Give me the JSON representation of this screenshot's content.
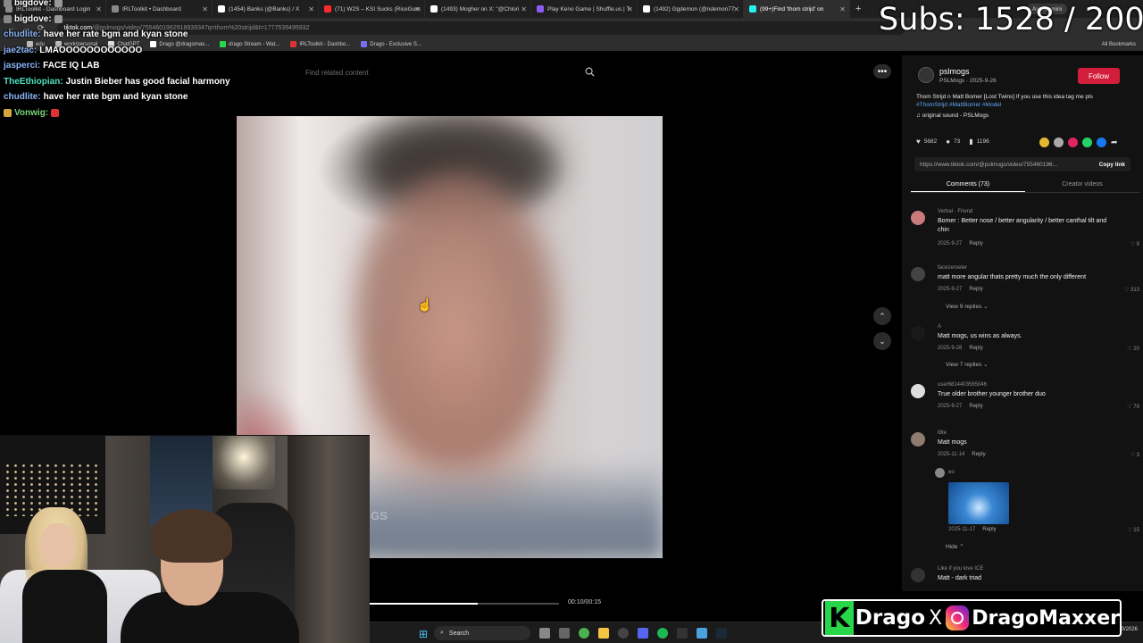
{
  "browser": {
    "tabs": [
      {
        "label": "IRLToolkit - Dashboard Login",
        "color": "#8a8a8a"
      },
      {
        "label": "IRLToolkit • Dashboard",
        "color": "#8a8a8a"
      },
      {
        "label": "(1454) Banks (@Banks) / X",
        "color": "#ffffff"
      },
      {
        "label": "(71) W2S – KSI Sucks (RiceGum",
        "color": "#ff2a2a"
      },
      {
        "label": "(1493) Mogher on X: \"@Chlori",
        "color": "#ffffff"
      },
      {
        "label": "Play Keno Game | Shuffle.us | T",
        "color": "#8b5cf6"
      },
      {
        "label": "(1492) Ggdemon (@ndemon77",
        "color": "#ffffff"
      },
      {
        "label": "(99+)Find 'thom strijd' on",
        "color": "#25f4ee"
      }
    ],
    "new_tab": "+",
    "ask_gemini": "Ask Gemini",
    "nav": {
      "back": "←",
      "forward": "→",
      "reload": "⟳"
    },
    "url_host": "tiktok.com",
    "url_rest": "/@pslmogs/video/7554601962918939347q=thom%20strijd&t=1777539495932",
    "bookmarks": [
      "edu",
      "work/personal",
      "ChatGPT",
      "Drago @dragomax...",
      "drago Stream - Wat...",
      "IRLToolkit - Dashbo...",
      "Drago - Exclusive S..."
    ],
    "all_bookmarks": "All Bookmarks"
  },
  "overlay": {
    "subs_text": "Subs: 1528 / 2000"
  },
  "chat": [
    {
      "user": "bigdove:",
      "msg": "",
      "color": "#ffffff",
      "badge": "#888888"
    },
    {
      "user": "bigdove:",
      "msg": "",
      "color": "#ffffff",
      "badge": "#888888"
    },
    {
      "user": "chudlite:",
      "msg": "have her rate bgm and kyan stone",
      "color": "#ffffff",
      "badge": ""
    },
    {
      "user": "jae2tac:",
      "msg": "LMAOOOOOOOOOOOO",
      "color": "#8ab4f8",
      "badge": ""
    },
    {
      "user": "jasperci:",
      "msg": "FACE IQ LAB",
      "color": "#8ab4f8",
      "badge": ""
    },
    {
      "user": "TheEthiopian:",
      "msg": "Justin Bieber has good facial harmony",
      "color": "#4fe0c0",
      "badge": ""
    },
    {
      "user": "chudlite:",
      "msg": "have her rate bgm and kyan stone",
      "color": "#8ab4f8",
      "badge": ""
    },
    {
      "user": "Vonwig:",
      "msg": "",
      "color": "#7bd67b",
      "badge": "#d4a53a"
    }
  ],
  "tiktok": {
    "search_placeholder": "Find related content",
    "more": "•••",
    "video_watermark": "GS",
    "video_time": "00:10/00:15",
    "progress": 0.57,
    "nav_up": "⌃",
    "nav_down": "⌄",
    "author": {
      "name": "pslmogs",
      "sub": "PSLMogs · 2025-9-26",
      "follow": "Follow"
    },
    "caption": "Thom Strijd n Matt Bomer [Lost Twins] If you use this idea tag me pls",
    "tags": "#ThomStrijd #MattBomer #Model",
    "sound": "♫  original sound - PSLMogs",
    "stats": {
      "likes": "5682",
      "comments": "73",
      "saves": "1196"
    },
    "link": "https://www.tiktok.com/@pslmogs/video/75546019­6...",
    "copy_link": "Copy link",
    "tabs": [
      "Comments (73)",
      "Creator videos"
    ],
    "comments": [
      {
        "user": "Verbal · Friend",
        "text": "Bomer : Better nose / better angularity / better canthal tilt and chin",
        "date": "2025-9-27",
        "reply": "Reply",
        "likes": "♡ 9"
      },
      {
        "user": "facezeroeler",
        "text": "matt more angular thats pretty much the only different",
        "date": "2025-9-27",
        "reply": "Reply",
        "likes": "♡ 313",
        "view": "View 9 replies ⌄"
      },
      {
        "user": "A",
        "text": "Matt mogs, us wins as always.",
        "date": "2025-9-28",
        "reply": "Reply",
        "likes": "♡ 20",
        "view": "View 7 replies ⌄"
      },
      {
        "user": "user6814403565046",
        "text": "True older brother younger brother duo",
        "date": "2025-9-27",
        "reply": "Reply",
        "likes": "♡ 79"
      },
      {
        "user": "t8te",
        "text": "Matt mogs",
        "date": "2025-11-14",
        "reply": "Reply",
        "likes": "♡ 3"
      },
      {
        "user": "Like if you love ICE",
        "text": "Matt - dark triad",
        "date": "",
        "reply": "",
        "likes": ""
      }
    ],
    "nested_reply": {
      "user": "eo",
      "date": "2025-11-17",
      "reply": "Reply",
      "likes": "♡ 15",
      "hide": "Hide ⌃"
    }
  },
  "taskbar": {
    "search": "Search",
    "date": "4/30/2026"
  },
  "banner": {
    "k": "K",
    "name": "Drago",
    "x": "X",
    "handle": "DragoMaxxer"
  },
  "colors": {
    "accent_follow": "#d21e3b",
    "tag_blue": "#5fa9f5",
    "kick_green": "#28d64a"
  }
}
